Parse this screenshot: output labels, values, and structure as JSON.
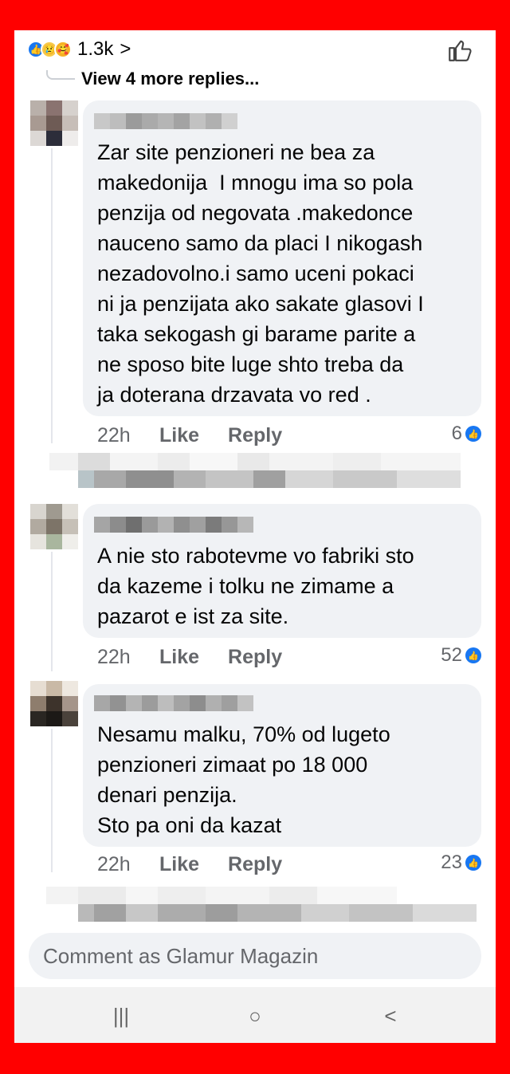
{
  "top": {
    "reaction_count": "1.3k",
    "chevron": ">",
    "view_more": "View 4 more replies..."
  },
  "comments": [
    {
      "text": "Zar site penzioneri ne bea za\nmakedonija  I mnogu ima so pola\npenzija od negovata .makedonce\nnauceno samo da placi I nikogash\nnezadovolno.i samo uceni pokaci\nni ja penzijata ako sakate glasovi I\ntaka sekogash gi barame parite a\nne sposo bite luge shto treba da\nja doterana drzavata vo red .",
      "time": "22h",
      "like": "Like",
      "reply": "Reply",
      "likes": "6"
    },
    {
      "text": "A nie sto rabotevme vo fabriki sto\nda kazeme i tolku ne zimame a\npazarot e ist za site.",
      "time": "22h",
      "like": "Like",
      "reply": "Reply",
      "likes": "52"
    },
    {
      "text": "Nesamu malku, 70% od lugeto\npenzioneri zimaat po 18 000\ndenari penzija.\nSto pa oni da kazat",
      "time": "22h",
      "like": "Like",
      "reply": "Reply",
      "likes": "23"
    }
  ],
  "compose": {
    "placeholder": "Comment as Glamur Magazin"
  },
  "navbar": {
    "recent": "|||",
    "home": "○",
    "back": "<"
  },
  "colors": {
    "border": "#ff0000",
    "accent": "#1877f2",
    "bubble": "#f0f2f5",
    "muted": "#65676b"
  },
  "icons": [
    "like-reaction-icon",
    "sad-reaction-icon",
    "care-reaction-icon",
    "thumbs-up-icon",
    "recent-apps-icon",
    "home-icon",
    "back-icon"
  ]
}
